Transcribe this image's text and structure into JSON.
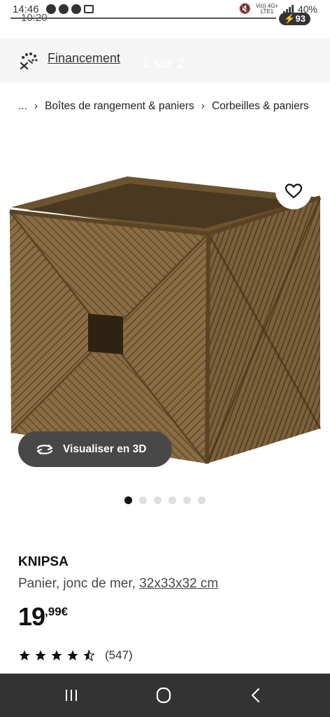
{
  "status_bar": {
    "time": "14:46",
    "time_secondary": "10:20",
    "network": "Vo)) 4G+ LTE1",
    "battery_percent": "40%",
    "battery_badge": "93"
  },
  "finance": {
    "link_label": "Financement",
    "icon": "finance-sparkle-icon",
    "carousel_counter": "1 sur 2"
  },
  "breadcrumb": {
    "ellipsis": "...",
    "items": [
      "Boîtes de rangement & paniers",
      "Corbeilles & paniers"
    ]
  },
  "gallery": {
    "image": "seagrass-basket-image",
    "view_3d_label": "Visualiser en 3D",
    "dot_count": 6,
    "active_dot": 1
  },
  "product": {
    "name": "KNIPSA",
    "description": "Panier, jonc de mer,",
    "dimensions": "32x33x32 cm",
    "price_int": "19",
    "price_dec": ",99€",
    "rating": 4.5,
    "review_count": "(547)"
  },
  "colors": {
    "dark_button": "#484848",
    "nav_bar": "#333333",
    "finance_bg": "#f5f5f5"
  }
}
